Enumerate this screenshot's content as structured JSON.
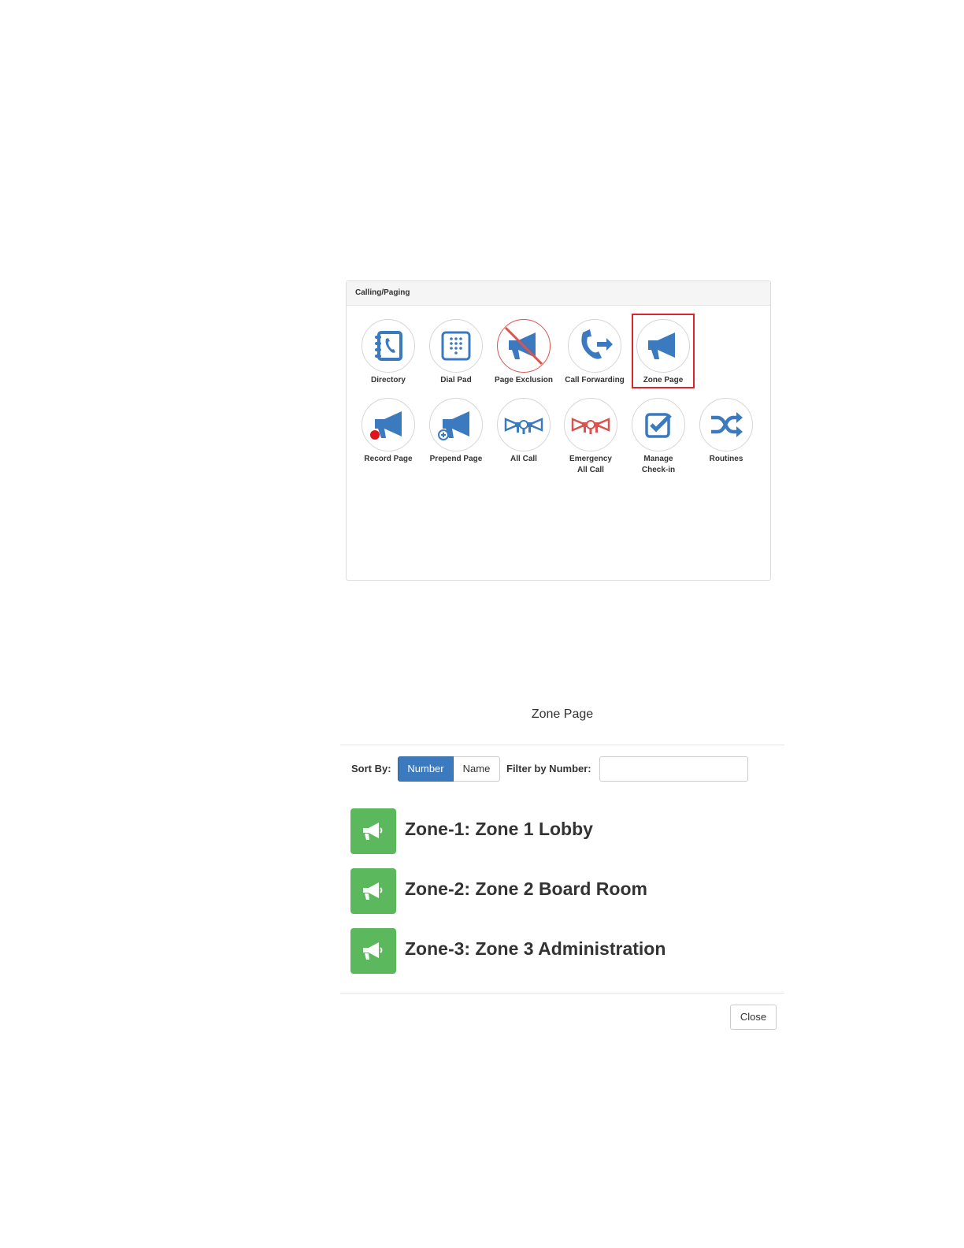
{
  "panel": {
    "title": "Calling/Paging",
    "tiles": [
      {
        "label": "Directory",
        "icon": "directory-phonebook-icon"
      },
      {
        "label": "Dial Pad",
        "icon": "dial-pad-icon"
      },
      {
        "label": "Page Exclusion",
        "icon": "page-exclusion-icon"
      },
      {
        "label": "Call Forwarding",
        "icon": "call-forwarding-icon"
      },
      {
        "label": "Zone Page",
        "icon": "megaphone-icon",
        "highlighted": true
      },
      {
        "label": "Record Page",
        "icon": "record-page-icon"
      },
      {
        "label": "Prepend Page",
        "icon": "prepend-page-icon"
      },
      {
        "label": "All Call",
        "icon": "all-call-icon"
      },
      {
        "label_line1": "Emergency",
        "label_line2": "All Call",
        "icon": "emergency-all-call-icon"
      },
      {
        "label_line1": "Manage",
        "label_line2": "Check-in",
        "icon": "checkbox-icon"
      },
      {
        "label": "Routines",
        "icon": "shuffle-icon"
      }
    ],
    "highlight_color": "#d9262c"
  },
  "modal": {
    "title": "Zone Page",
    "sort_label": "Sort By:",
    "sort_options": [
      "Number",
      "Name"
    ],
    "sort_selected": "Number",
    "filter_label": "Filter by Number:",
    "filter_value": "",
    "zones": [
      {
        "label": "Zone-1: Zone 1 Lobby"
      },
      {
        "label": "Zone-2: Zone 2 Board Room"
      },
      {
        "label": "Zone-3: Zone 3 Administration"
      }
    ],
    "close_label": "Close"
  },
  "colors": {
    "icon_blue": "#3c7abf",
    "icon_red": "#d9534f",
    "zone_green": "#5cb85c",
    "selected_blue": "#3c7abf"
  }
}
